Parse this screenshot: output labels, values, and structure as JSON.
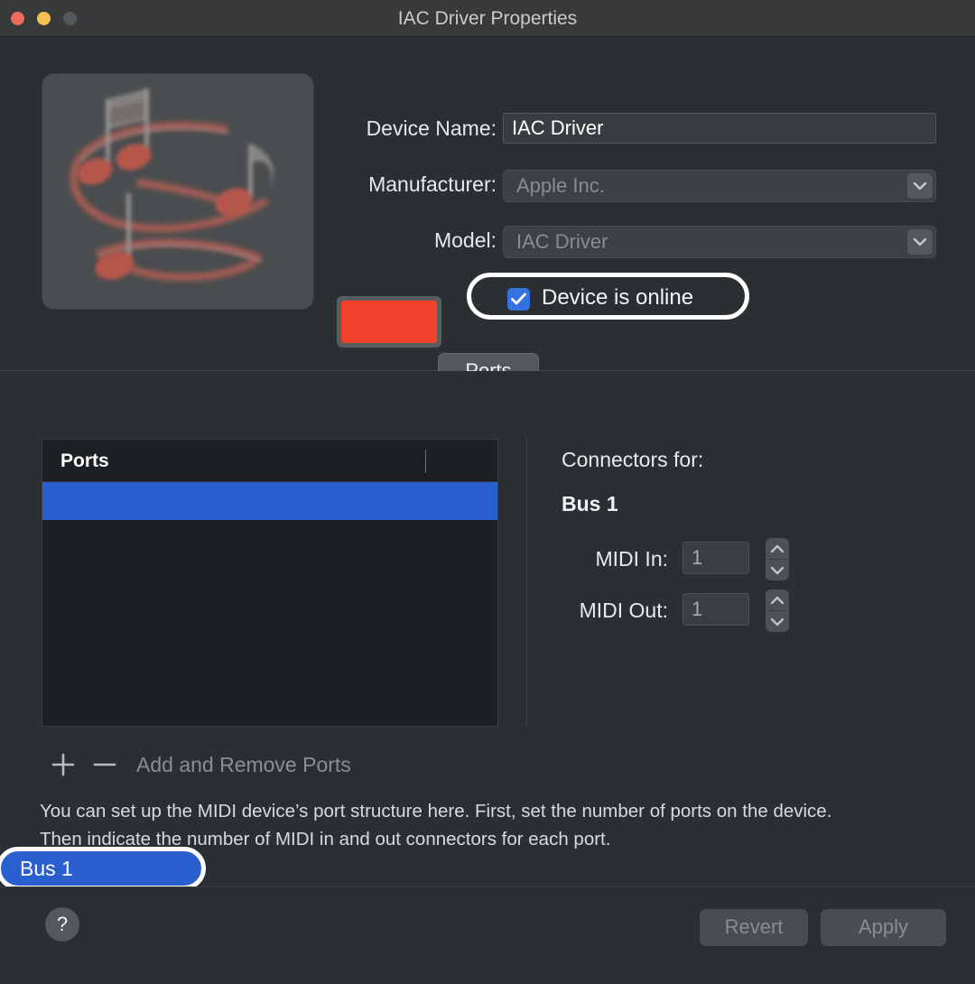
{
  "window": {
    "title": "IAC Driver Properties",
    "traffic_lights": [
      "close",
      "minimize",
      "zoom"
    ]
  },
  "device": {
    "icon_name": "music-notes-icon",
    "labels": {
      "device_name": "Device Name:",
      "manufacturer": "Manufacturer:",
      "model": "Model:"
    },
    "device_name_value": "IAC Driver",
    "device_name_placeholder": "Device Name",
    "manufacturer_value": "Apple Inc.",
    "model_value": "IAC Driver",
    "online_label": "Device is online",
    "online_checked": true,
    "color_swatch": "#f0412a"
  },
  "tabs": {
    "ports": "Ports"
  },
  "ports": {
    "header": "Ports",
    "items": [
      {
        "label": "Bus 1",
        "selected": true
      }
    ],
    "add_label": "+",
    "remove_label": "−",
    "addremove_text": "Add and Remove Ports"
  },
  "connectors": {
    "title": "Connectors for:",
    "subject": "Bus 1",
    "midi_in_label": "MIDI In:",
    "midi_in_value": "1",
    "midi_out_label": "MIDI Out:",
    "midi_out_value": "1"
  },
  "help": {
    "line1": "You can set up the MIDI device’s port structure here. First, set the number of ports on the device.",
    "line2": "Then indicate the number of MIDI in and out connectors for each port."
  },
  "footer": {
    "help_label": "?",
    "revert_label": "Revert",
    "apply_label": "Apply",
    "revert_enabled": false,
    "apply_enabled": false
  },
  "colors": {
    "accent_blue": "#3372e0",
    "selection_blue": "#2a5fd0",
    "highlight_ring": "#ffffff",
    "swatch_red": "#f0412a"
  }
}
